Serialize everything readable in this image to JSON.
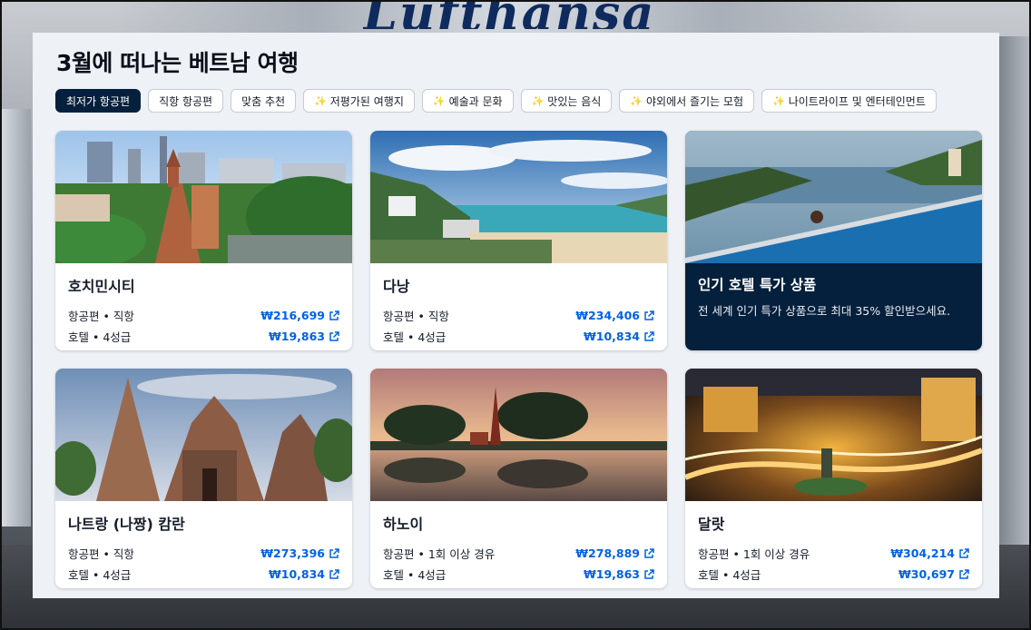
{
  "background": {
    "brand_text": "Lufthansa"
  },
  "page": {
    "title": "3월에 떠나는 베트남 여행"
  },
  "filters": [
    {
      "label": "최저가 항공편",
      "active": true,
      "sparkle": false
    },
    {
      "label": "직항 항공편",
      "active": false,
      "sparkle": false
    },
    {
      "label": "맞춤 추천",
      "active": false,
      "sparkle": false
    },
    {
      "label": "저평가된 여행지",
      "active": false,
      "sparkle": true
    },
    {
      "label": "예술과 문화",
      "active": false,
      "sparkle": true
    },
    {
      "label": "맛있는 음식",
      "active": false,
      "sparkle": true
    },
    {
      "label": "야외에서 즐기는 모험",
      "active": false,
      "sparkle": true
    },
    {
      "label": "나이트라이프 및 엔터테인먼트",
      "active": false,
      "sparkle": true
    }
  ],
  "sparkle_glyph": "✨",
  "destinations": [
    {
      "name": "호치민시티",
      "flight_label": "항공편 • 직항",
      "flight_price": "₩216,699",
      "hotel_label": "호텔 • 4성급",
      "hotel_price": "₩19,863"
    },
    {
      "name": "다낭",
      "flight_label": "항공편 • 직항",
      "flight_price": "₩234,406",
      "hotel_label": "호텔 • 4성급",
      "hotel_price": "₩10,834"
    },
    {
      "name": "나트랑 (나짱) 캄란",
      "flight_label": "항공편 • 직항",
      "flight_price": "₩273,396",
      "hotel_label": "호텔 • 4성급",
      "hotel_price": "₩10,834"
    },
    {
      "name": "하노이",
      "flight_label": "항공편 • 1회 이상 경유",
      "flight_price": "₩278,889",
      "hotel_label": "호텔 • 4성급",
      "hotel_price": "₩19,863"
    },
    {
      "name": "달랏",
      "flight_label": "항공편 • 1회 이상 경유",
      "flight_price": "₩304,214",
      "hotel_label": "호텔 • 4성급",
      "hotel_price": "₩30,697"
    }
  ],
  "promo": {
    "title": "인기 호텔 특가 상품",
    "description": "전 세계 인기 특가 상품으로 최대 35% 할인받으세요."
  },
  "colors": {
    "accent": "#0062e3",
    "navy": "#05203c",
    "panel": "#eef1f5"
  },
  "icons": {
    "external_link": "external-link-icon",
    "sparkle": "sparkle-icon"
  }
}
